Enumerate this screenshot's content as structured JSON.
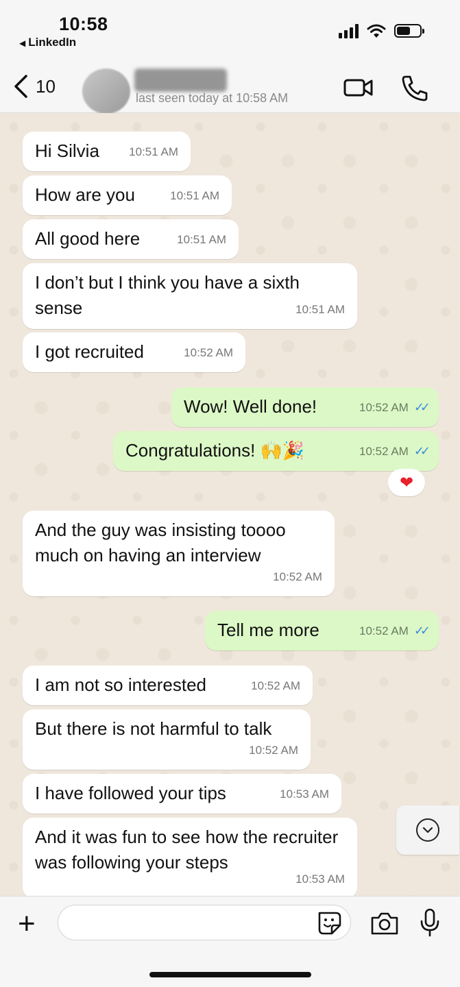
{
  "status_bar": {
    "time": "10:58",
    "back_app": "LinkedIn"
  },
  "header": {
    "back_count": "10",
    "last_seen": "last seen today at 10:58 AM",
    "icons": [
      "chevron-left-icon",
      "video-call-icon",
      "phone-icon"
    ]
  },
  "messages": [
    {
      "text": "Hi Silvia",
      "time": "10:51 AM",
      "direction": "in"
    },
    {
      "text": "How are you",
      "time": "10:51 AM",
      "direction": "in"
    },
    {
      "text": "All good here",
      "time": "10:51 AM",
      "direction": "in"
    },
    {
      "text": "I don’t but I think you have a sixth sense",
      "time": "10:51 AM",
      "direction": "in"
    },
    {
      "text": "I got recruited",
      "time": "10:52 AM",
      "direction": "in"
    },
    {
      "text": "Wow! Well done!",
      "time": "10:52 AM",
      "direction": "out"
    },
    {
      "text": "Congratulations! 🙌🎉",
      "time": "10:52 AM",
      "direction": "out"
    },
    {
      "text": "And the guy was insisting toooo much on having an interview",
      "time": "10:52 AM",
      "direction": "in"
    },
    {
      "text": "Tell me more",
      "time": "10:52 AM",
      "direction": "out"
    },
    {
      "text": "I am not so interested",
      "time": "10:52 AM",
      "direction": "in"
    },
    {
      "text": "But there is not harmful to talk",
      "time": "10:52 AM",
      "direction": "in"
    },
    {
      "text": "I have followed your tips",
      "time": "10:53 AM",
      "direction": "in"
    },
    {
      "text": "And it was fun to see how the recruiter was following your steps",
      "time": "10:53 AM",
      "direction": "in"
    }
  ],
  "reaction": "❤",
  "colors": {
    "outgoing_bubble": "#dcf8c6",
    "incoming_bubble": "#ffffff",
    "read_ticks": "#3a8ce0",
    "chat_background": "#efe7dc"
  },
  "input": {
    "placeholder": ""
  }
}
